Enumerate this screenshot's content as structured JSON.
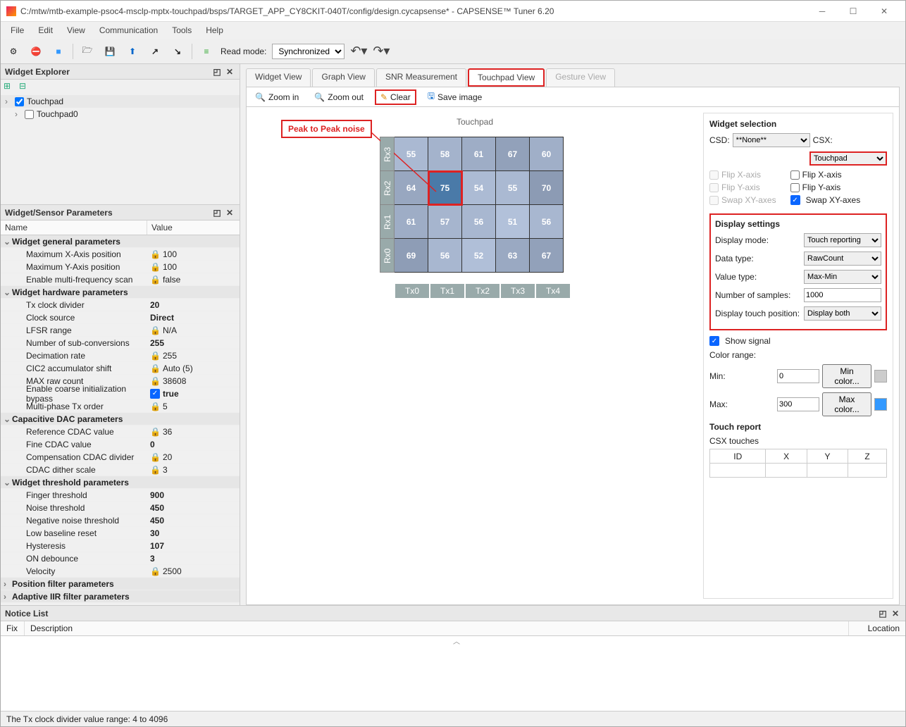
{
  "title": "C:/mtw/mtb-example-psoc4-msclp-mptx-touchpad/bsps/TARGET_APP_CY8CKIT-040T/config/design.cycapsense* - CAPSENSE™ Tuner 6.20",
  "menu": [
    "File",
    "Edit",
    "View",
    "Communication",
    "Tools",
    "Help"
  ],
  "toolbar": {
    "read_mode_label": "Read mode:",
    "read_mode_value": "Synchronized"
  },
  "explorer": {
    "title": "Widget Explorer",
    "items": [
      {
        "label": "Touchpad",
        "checked": true,
        "selected": true
      },
      {
        "label": "Touchpad0",
        "checked": false,
        "selected": false
      }
    ]
  },
  "params_panel_title": "Widget/Sensor Parameters",
  "params_head": {
    "name": "Name",
    "value": "Value"
  },
  "params": [
    {
      "group": "Widget general parameters"
    },
    {
      "name": "Maximum X-Axis position",
      "value": "100",
      "lock": true
    },
    {
      "name": "Maximum Y-Axis position",
      "value": "100",
      "lock": true
    },
    {
      "name": "Enable multi-frequency scan",
      "value": "false",
      "lock": true
    },
    {
      "group": "Widget hardware parameters"
    },
    {
      "name": "Tx clock divider",
      "value": "20",
      "bold": true
    },
    {
      "name": "Clock source",
      "value": "Direct",
      "bold": true
    },
    {
      "name": "LFSR range",
      "value": "N/A",
      "lock": true
    },
    {
      "name": "Number of sub-conversions",
      "value": "255",
      "bold": true
    },
    {
      "name": "Decimation rate",
      "value": "255",
      "lock": true
    },
    {
      "name": "CIC2 accumulator shift",
      "value": "Auto (5)",
      "lock": true
    },
    {
      "name": "MAX raw count",
      "value": "38608",
      "lock": true
    },
    {
      "name": "Enable coarse initialization bypass",
      "value": "true",
      "boldblue": true
    },
    {
      "name": "Multi-phase Tx order",
      "value": "5",
      "lock": true
    },
    {
      "group": "Capacitive DAC parameters"
    },
    {
      "name": "Reference CDAC value",
      "value": "36",
      "lock": true
    },
    {
      "name": "Fine CDAC value",
      "value": "0",
      "bold": true
    },
    {
      "name": "Compensation CDAC divider",
      "value": "20",
      "lock": true
    },
    {
      "name": "CDAC dither scale",
      "value": "3",
      "lock": true
    },
    {
      "group": "Widget threshold parameters"
    },
    {
      "name": "Finger threshold",
      "value": "900",
      "bold": true
    },
    {
      "name": "Noise threshold",
      "value": "450",
      "bold": true
    },
    {
      "name": "Negative noise threshold",
      "value": "450",
      "bold": true
    },
    {
      "name": "Low baseline reset",
      "value": "30",
      "bold": true
    },
    {
      "name": "Hysteresis",
      "value": "107",
      "bold": true
    },
    {
      "name": "ON debounce",
      "value": "3",
      "bold": true
    },
    {
      "name": "Velocity",
      "value": "2500",
      "lock": true
    },
    {
      "group": "Position filter parameters",
      "collapsed": true
    },
    {
      "group": "Adaptive IIR filter parameters",
      "collapsed": true
    }
  ],
  "tabs": {
    "widget": "Widget View",
    "graph": "Graph View",
    "snr": "SNR Measurement",
    "touchpad": "Touchpad View",
    "gesture": "Gesture View"
  },
  "subtoolbar": {
    "zoom_in": "Zoom in",
    "zoom_out": "Zoom out",
    "clear": "Clear",
    "save_image": "Save image"
  },
  "grid": {
    "title": "Touchpad",
    "annotation": "Peak to Peak noise",
    "row_labels": [
      "Rx3",
      "Rx2",
      "Rx1",
      "Rx0"
    ],
    "col_labels": [
      "Tx0",
      "Tx1",
      "Tx2",
      "Tx3",
      "Tx4"
    ],
    "cells": [
      [
        55,
        58,
        61,
        67,
        60
      ],
      [
        64,
        75,
        54,
        55,
        70
      ],
      [
        61,
        57,
        56,
        51,
        56
      ],
      [
        69,
        56,
        52,
        63,
        67
      ]
    ],
    "highlight_rc": [
      1,
      1
    ]
  },
  "side": {
    "widget_selection": "Widget selection",
    "csd_label": "CSD:",
    "csd_value": "**None**",
    "csx_label": "CSX:",
    "csx_value": "Touchpad",
    "flipx": "Flip X-axis",
    "flipy": "Flip Y-axis",
    "swap": "Swap XY-axes",
    "display_settings": "Display settings",
    "display_mode_label": "Display mode:",
    "display_mode_value": "Touch reporting",
    "data_type_label": "Data type:",
    "data_type_value": "RawCount",
    "value_type_label": "Value type:",
    "value_type_value": "Max-Min",
    "num_samples_label": "Number of samples:",
    "num_samples_value": "1000",
    "display_touch_label": "Display touch position:",
    "display_touch_value": "Display both",
    "show_signal": "Show signal",
    "color_range": "Color range:",
    "min_label": "Min:",
    "min_value": "0",
    "min_color_btn": "Min color...",
    "max_label": "Max:",
    "max_value": "300",
    "max_color_btn": "Max color...",
    "touch_report": "Touch report",
    "csx_touches": "CSX touches",
    "touch_cols": [
      "ID",
      "X",
      "Y",
      "Z"
    ]
  },
  "notice": {
    "title": "Notice List",
    "fix": "Fix",
    "description": "Description",
    "location": "Location"
  },
  "status": "The Tx clock divider value range: 4 to 4096"
}
